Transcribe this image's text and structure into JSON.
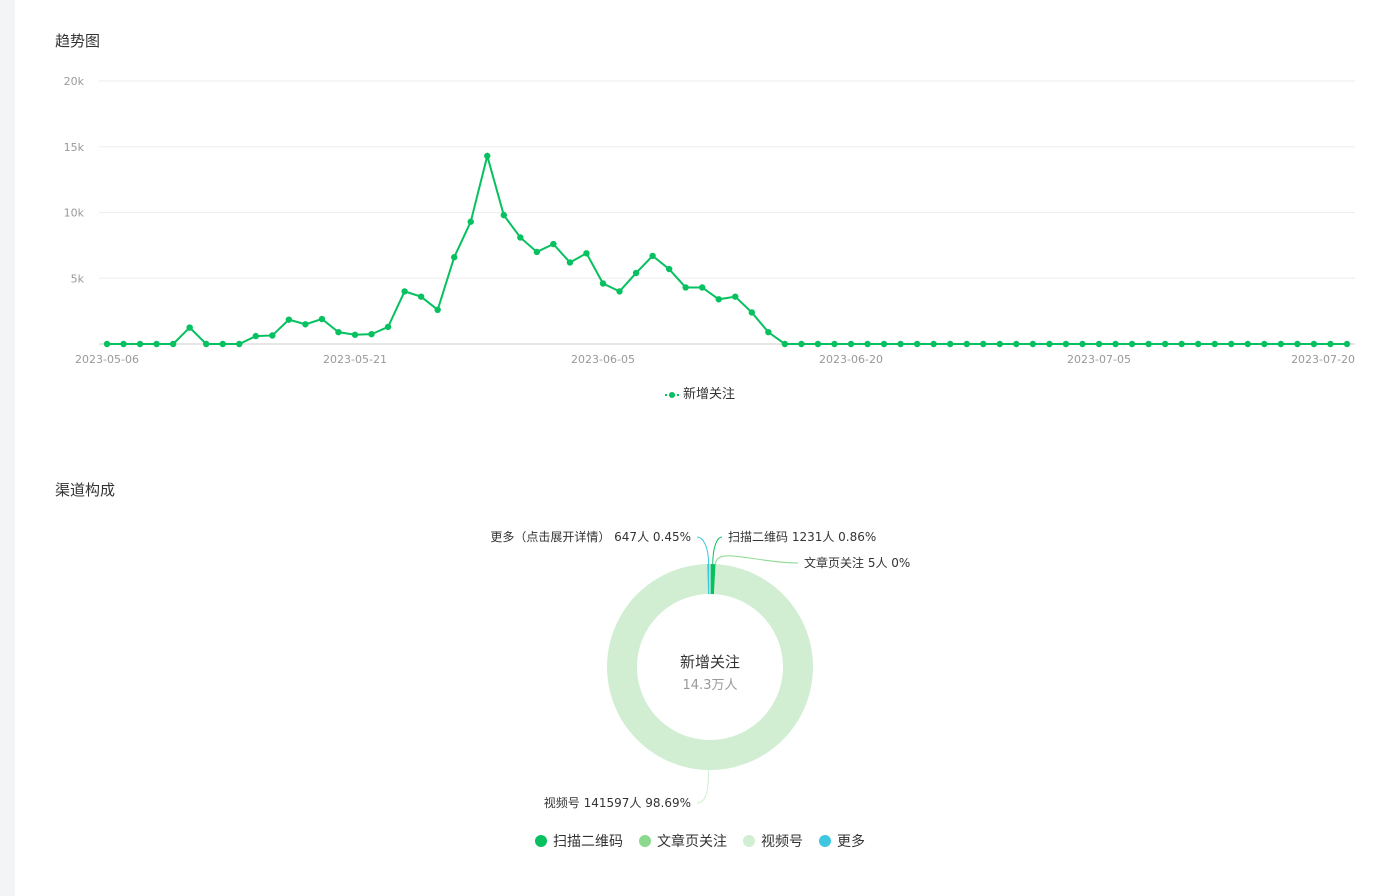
{
  "trend": {
    "title": "趋势图",
    "legend_label": "新增关注"
  },
  "channel": {
    "title": "渠道构成",
    "center_title": "新增关注",
    "center_value": "14.3万人",
    "legend": [
      {
        "label": "扫描二维码",
        "color": "#07c160"
      },
      {
        "label": "文章页关注",
        "color": "#8bd88f"
      },
      {
        "label": "视频号",
        "color": "#d1eed3"
      },
      {
        "label": "更多",
        "color": "#3ec7e0"
      }
    ]
  },
  "chart_data": [
    {
      "type": "line",
      "title": "",
      "xlabel": "",
      "ylabel": "",
      "ylim": [
        0,
        20000
      ],
      "y_ticks": [
        "5k",
        "10k",
        "15k",
        "20k"
      ],
      "x_tick_labels": [
        "2023-05-06",
        "2023-05-21",
        "2023-06-05",
        "2023-06-20",
        "2023-07-05",
        "2023-07-20"
      ],
      "x_start": "2023-05-06",
      "x_end": "2023-07-20",
      "grid": true,
      "legend_position": "bottom",
      "series": [
        {
          "name": "新增关注",
          "color": "#07c160",
          "values": [
            0,
            0,
            0,
            0,
            0,
            1250,
            0,
            0,
            0,
            600,
            650,
            1850,
            1500,
            1900,
            900,
            700,
            750,
            1300,
            4000,
            3600,
            2600,
            6600,
            9300,
            14300,
            9800,
            8100,
            7000,
            7600,
            6200,
            6900,
            4600,
            4000,
            5400,
            6700,
            5700,
            4300,
            4300,
            3400,
            3600,
            2400,
            900,
            0,
            0,
            0,
            0,
            0,
            0,
            0,
            0,
            0,
            0,
            0,
            0,
            0,
            0,
            0,
            0,
            0,
            0,
            0,
            0,
            0,
            0,
            0,
            0,
            0,
            0,
            0,
            0,
            0,
            0,
            0,
            0,
            0,
            0,
            0
          ]
        }
      ]
    },
    {
      "type": "pie",
      "title": "",
      "slices": [
        {
          "name": "扫描二维码",
          "value": 1231,
          "percent": "0.86%",
          "label": "扫描二维码 1231人 0.86%",
          "color": "#07c160"
        },
        {
          "name": "文章页关注",
          "value": 5,
          "percent": "0%",
          "label": "文章页关注 5人 0%",
          "color": "#8bd88f"
        },
        {
          "name": "视频号",
          "value": 141597,
          "percent": "98.69%",
          "label": "视频号 141597人 98.69%",
          "color": "#d1eed3"
        },
        {
          "name": "更多",
          "value": 647,
          "percent": "0.45%",
          "label": "更多（点击展开详情） 647人 0.45%",
          "color": "#3ec7e0"
        }
      ]
    }
  ]
}
